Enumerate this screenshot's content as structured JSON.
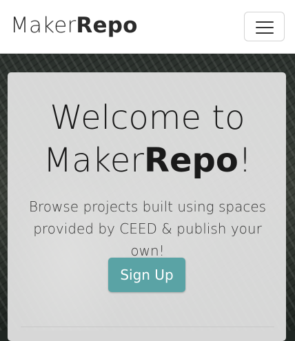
{
  "navbar": {
    "brand_light": "Maker",
    "brand_bold": "Repo",
    "menu_icon": "hamburger-menu-icon"
  },
  "hero": {
    "title_line1": "Welcome to",
    "title_line2_light": "Maker",
    "title_line2_bold": "Repo",
    "title_line2_suffix": "!",
    "subtitle": "Browse projects built using spaces provided by CEED & publish your own!",
    "signup_label": "Sign Up"
  },
  "colors": {
    "accent": "#5aa3a5",
    "navbar_bg": "#ffffff",
    "card_bg": "#e5e5e5"
  }
}
